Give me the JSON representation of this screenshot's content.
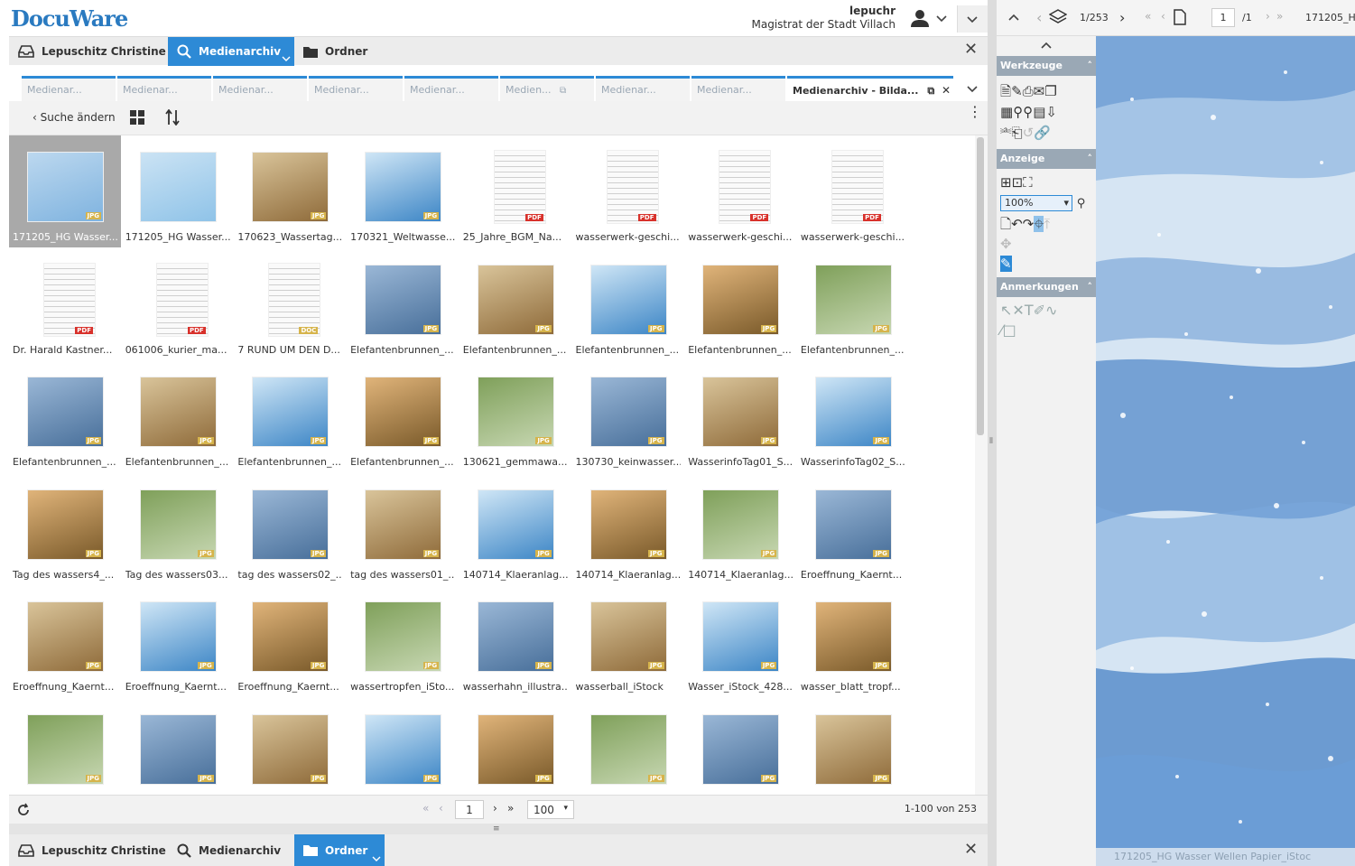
{
  "app": {
    "logo": "DocuWare",
    "user_name": "lepuchr",
    "organization": "Magistrat der Stadt Villach"
  },
  "tabs": [
    {
      "label": "Lepuschitz Christine",
      "icon": "tray-icon",
      "active": false
    },
    {
      "label": "Medienarchiv",
      "icon": "search-icon",
      "active": true
    },
    {
      "label": "Ordner",
      "icon": "folder-icon",
      "active": false
    }
  ],
  "subtabs": [
    {
      "label": "Medienar..."
    },
    {
      "label": "Medienar..."
    },
    {
      "label": "Medienar..."
    },
    {
      "label": "Medienar..."
    },
    {
      "label": "Medienar..."
    },
    {
      "label": "Medien..."
    },
    {
      "label": "Medienar..."
    },
    {
      "label": "Medienar..."
    },
    {
      "label": "Medienarchiv - Bilda...",
      "active": true
    }
  ],
  "toolbar": {
    "back_label": "Suche ändern"
  },
  "results": [
    {
      "caption": "171205_HG Wasser...",
      "type": "JPG",
      "selected": true
    },
    {
      "caption": "171205_HG Wasser...",
      "type": ""
    },
    {
      "caption": "170623_Wassertag...",
      "type": "JPG"
    },
    {
      "caption": "170321_Weltwasse...",
      "type": "JPG"
    },
    {
      "caption": "25_Jahre_BGM_Na...",
      "type": "PDF"
    },
    {
      "caption": "wasserwerk-geschi...",
      "type": "PDF"
    },
    {
      "caption": "wasserwerk-geschi...",
      "type": "PDF"
    },
    {
      "caption": "wasserwerk-geschi...",
      "type": "PDF"
    },
    {
      "caption": "Dr. Harald Kastner...",
      "type": "PDF"
    },
    {
      "caption": "061006_kurier_ma...",
      "type": "PDF"
    },
    {
      "caption": "7 RUND UM DEN D...",
      "type": "DOC"
    },
    {
      "caption": "Elefantenbrunnen_...",
      "type": "JPG"
    },
    {
      "caption": "Elefantenbrunnen_...",
      "type": "JPG"
    },
    {
      "caption": "Elefantenbrunnen_...",
      "type": "JPG"
    },
    {
      "caption": "Elefantenbrunnen_...",
      "type": "JPG"
    },
    {
      "caption": "Elefantenbrunnen_...",
      "type": "JPG"
    },
    {
      "caption": "Elefantenbrunnen_...",
      "type": "JPG"
    },
    {
      "caption": "Elefantenbrunnen_...",
      "type": "JPG"
    },
    {
      "caption": "Elefantenbrunnen_...",
      "type": "JPG"
    },
    {
      "caption": "Elefantenbrunnen_...",
      "type": "JPG"
    },
    {
      "caption": "130621_gemmawa...",
      "type": "JPG"
    },
    {
      "caption": "130730_keinwasser...",
      "type": "JPG"
    },
    {
      "caption": "WasserinfoTag01_S...",
      "type": "JPG"
    },
    {
      "caption": "WasserinfoTag02_S...",
      "type": "JPG"
    },
    {
      "caption": "Tag des wassers4_...",
      "type": "JPG"
    },
    {
      "caption": "Tag des wassers03...",
      "type": "JPG"
    },
    {
      "caption": "tag des wassers02_...",
      "type": "JPG"
    },
    {
      "caption": "tag des wassers01_...",
      "type": "JPG"
    },
    {
      "caption": "140714_Klaeranlag...",
      "type": "JPG"
    },
    {
      "caption": "140714_Klaeranlag...",
      "type": "JPG"
    },
    {
      "caption": "140714_Klaeranlag...",
      "type": "JPG"
    },
    {
      "caption": "Eroeffnung_Kaernt...",
      "type": "JPG"
    },
    {
      "caption": "Eroeffnung_Kaernt...",
      "type": "JPG"
    },
    {
      "caption": "Eroeffnung_Kaernt...",
      "type": "JPG"
    },
    {
      "caption": "Eroeffnung_Kaernt...",
      "type": "JPG"
    },
    {
      "caption": "wassertropfen_iSto...",
      "type": "JPG"
    },
    {
      "caption": "wasserhahn_illustra...",
      "type": "JPG"
    },
    {
      "caption": "wasserball_iStock",
      "type": "JPG"
    },
    {
      "caption": "Wasser_iStock_428...",
      "type": "JPG"
    },
    {
      "caption": "wasser_blatt_tropf...",
      "type": "JPG"
    },
    {
      "caption": "",
      "type": "JPG"
    },
    {
      "caption": "",
      "type": "JPG"
    },
    {
      "caption": "",
      "type": "JPG"
    },
    {
      "caption": "",
      "type": "JPG"
    },
    {
      "caption": "",
      "type": "JPG"
    },
    {
      "caption": "",
      "type": "JPG"
    },
    {
      "caption": "",
      "type": "JPG"
    },
    {
      "caption": "",
      "type": "JPG"
    }
  ],
  "pager": {
    "page": "1",
    "page_size": "100",
    "range": "1-100 von 253"
  },
  "bottom_tabs": [
    {
      "label": "Lepuschitz Christine",
      "icon": "tray-icon",
      "active": false
    },
    {
      "label": "Medienarchiv",
      "icon": "search-icon",
      "active": false
    },
    {
      "label": "Ordner",
      "icon": "folder-icon",
      "active": true
    }
  ],
  "viewer": {
    "doc_count": "1/253",
    "page": "1",
    "page_total": "/1",
    "doc_name": "171205_H",
    "footer_name": "171205_HG Wasser Wellen Papier_iStoc"
  },
  "tools_panel": {
    "section_tools": "Werkzeuge",
    "section_view": "Anzeige",
    "zoom": "100%",
    "section_annotations": "Anmerkungen"
  },
  "colors": {
    "accent": "#2d8ad6",
    "panel_header": "#9aa8b5",
    "pdf_badge": "#d8312b",
    "jpg_badge": "#d6b44b"
  }
}
